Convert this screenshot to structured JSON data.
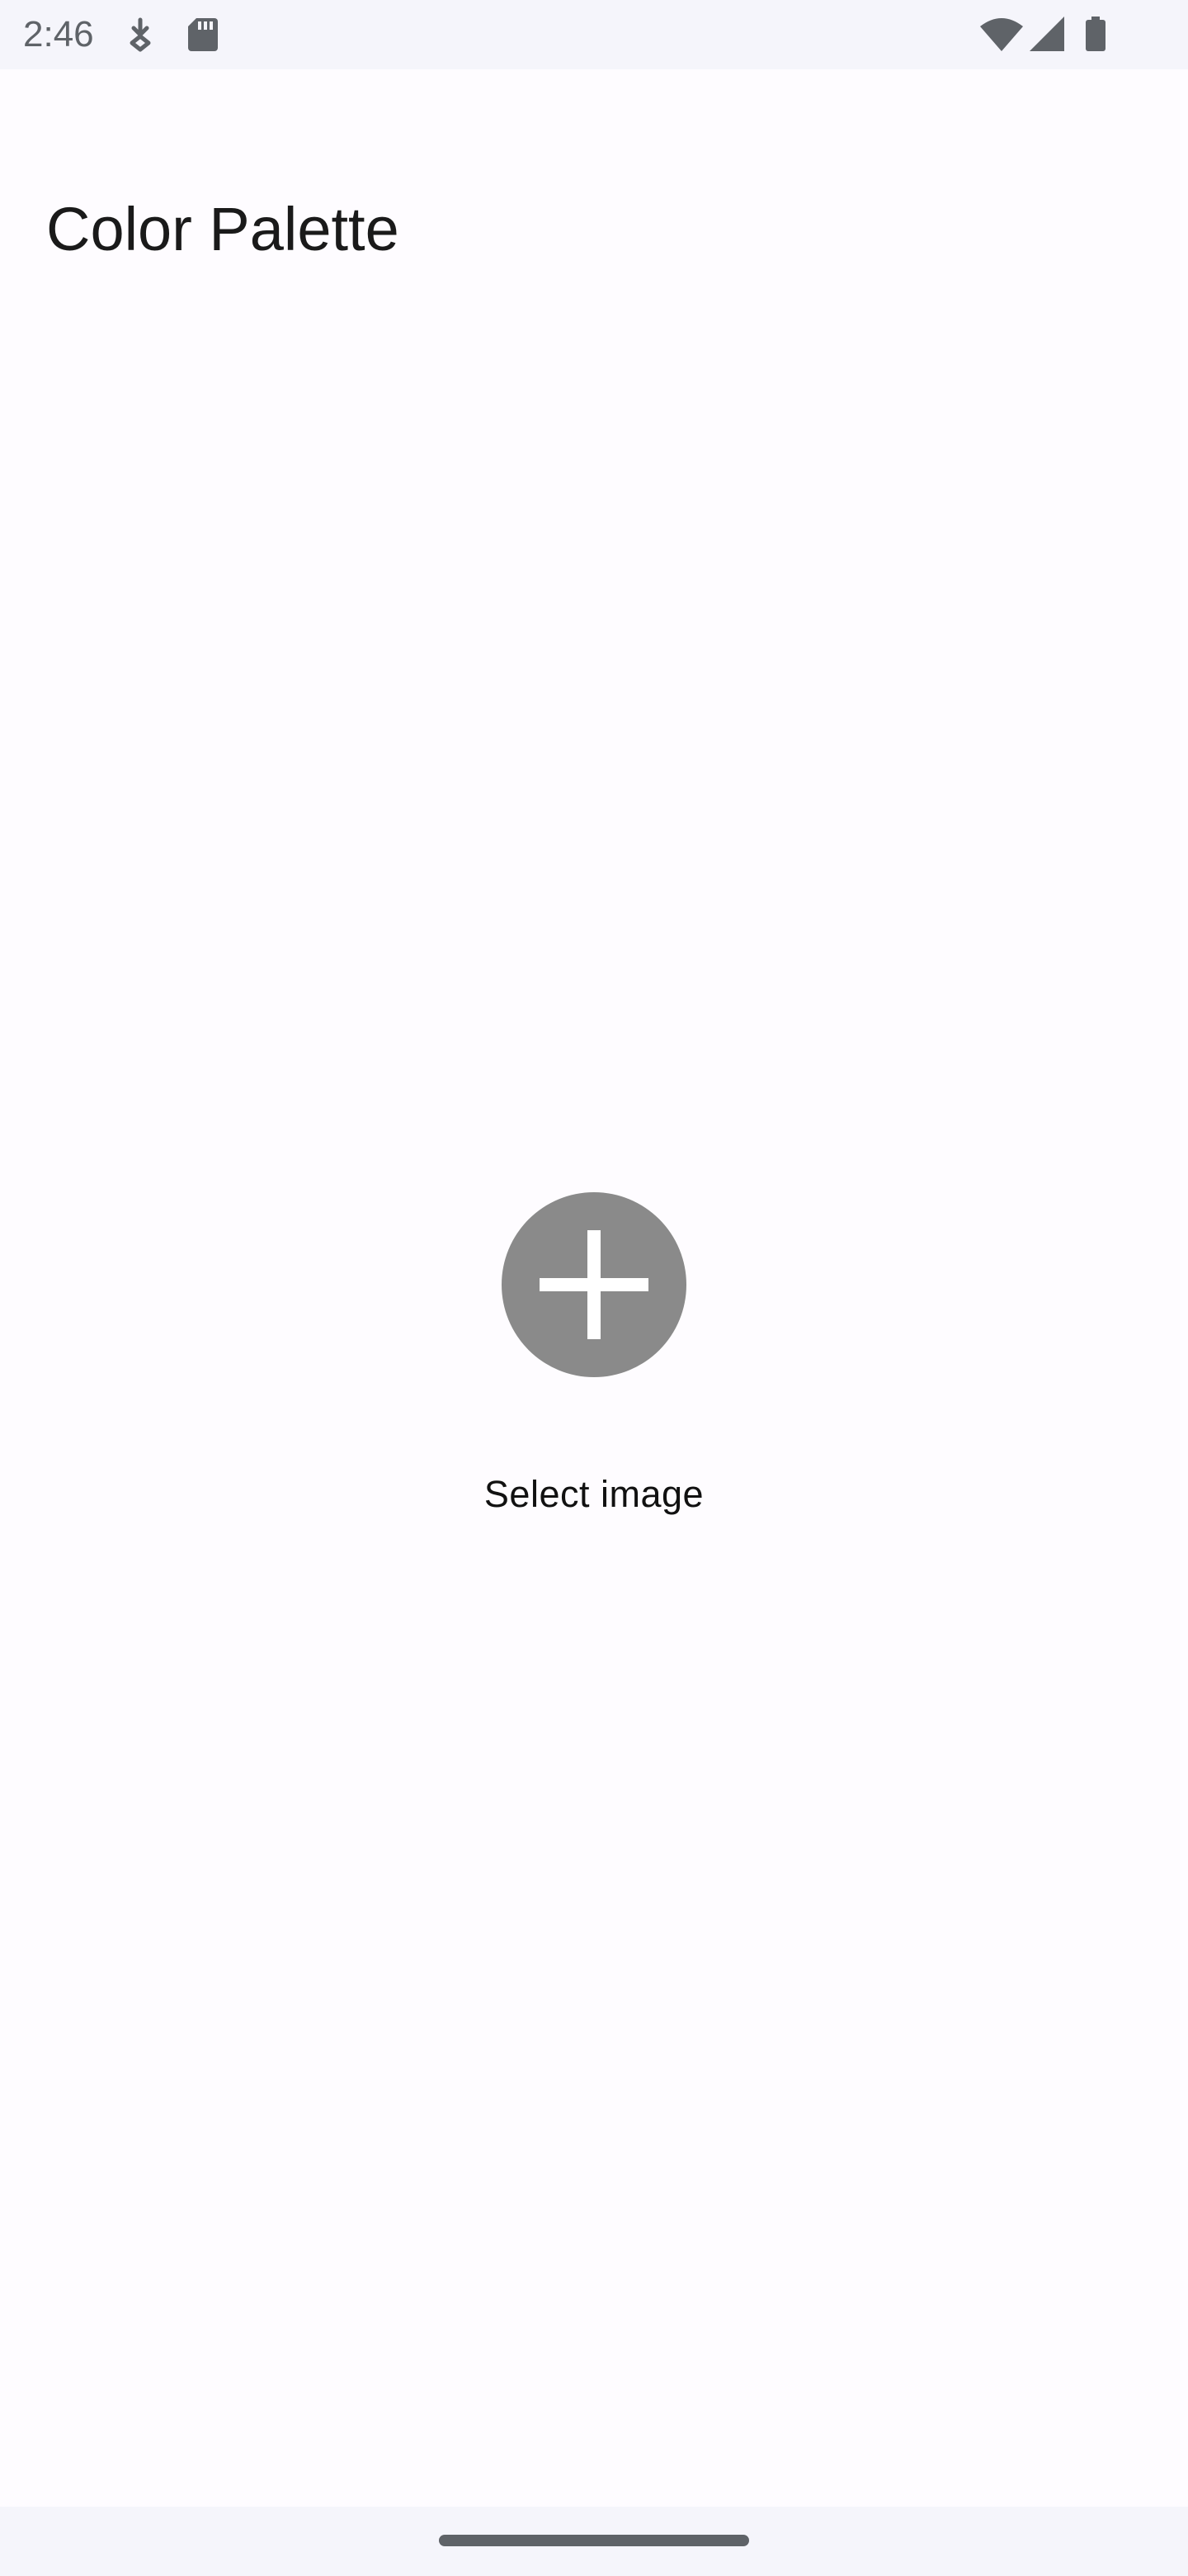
{
  "status_bar": {
    "time": "2:46",
    "left_icons": [
      "download-notification-icon",
      "sd-card-icon"
    ],
    "right_icons": [
      "wifi-icon",
      "cell-signal-icon",
      "battery-icon"
    ],
    "icon_color": "#5f6368"
  },
  "app_bar": {
    "title": "Color Palette"
  },
  "picker": {
    "button_icon": "add-icon",
    "button_color": "#8a8a8a",
    "label": "Select image"
  },
  "nav_bar": {
    "handle_icon": "home-gesture-handle"
  }
}
